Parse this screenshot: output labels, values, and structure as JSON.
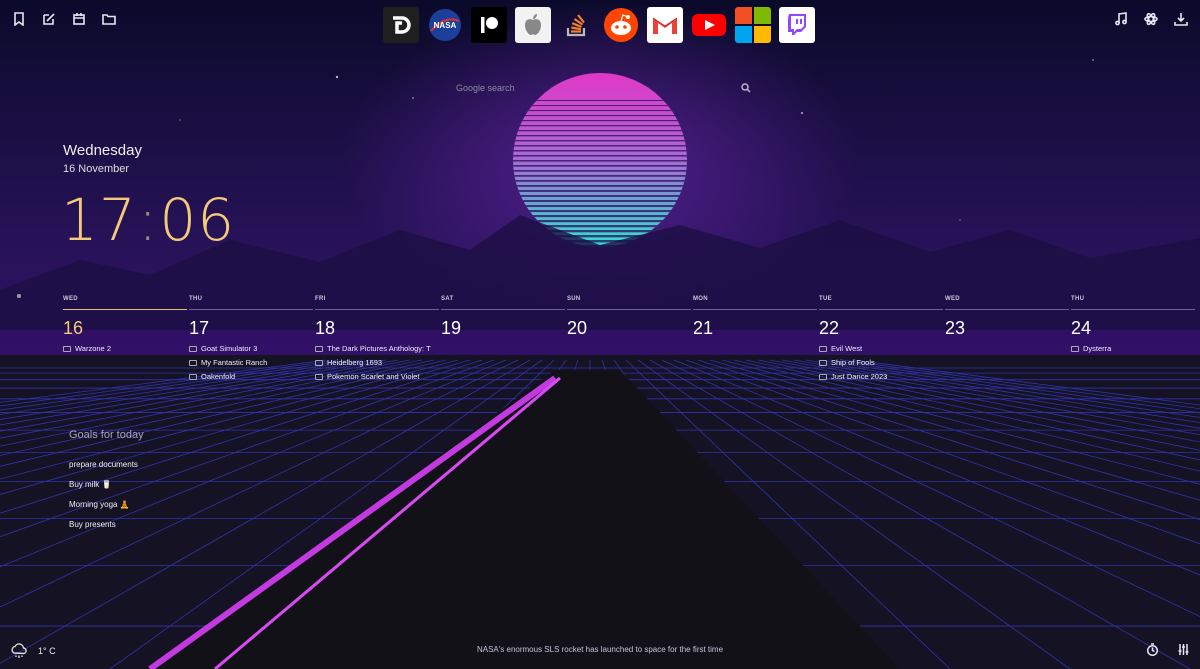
{
  "search": {
    "placeholder": "Google search"
  },
  "datetime": {
    "weekday": "Wednesday",
    "date": "16 November",
    "hours": "17",
    "minutes": "06"
  },
  "calendar": {
    "days": [
      {
        "wd": "WED",
        "num": "16",
        "events": [
          "Warzone 2"
        ]
      },
      {
        "wd": "THU",
        "num": "17",
        "events": [
          "Goat Simulator 3",
          "My Fantastic Ranch",
          "Oakenfold"
        ]
      },
      {
        "wd": "FRI",
        "num": "18",
        "events": [
          "The Dark Pictures Anthology: T",
          "Heidelberg 1693",
          "Pokemon Scarlet and Violet"
        ]
      },
      {
        "wd": "SAT",
        "num": "19",
        "events": []
      },
      {
        "wd": "SUN",
        "num": "20",
        "events": []
      },
      {
        "wd": "MON",
        "num": "21",
        "events": []
      },
      {
        "wd": "TUE",
        "num": "22",
        "events": [
          "Evil West",
          "Ship of Fools",
          "Just Dance 2023"
        ]
      },
      {
        "wd": "WED",
        "num": "23",
        "events": []
      },
      {
        "wd": "THU",
        "num": "24",
        "events": [
          "Dysterra"
        ]
      }
    ]
  },
  "goals": {
    "title": "Goals for today",
    "items": [
      "prepare documents",
      "Buy milk 🥛",
      "Morning yoga 🧘",
      "Buy presents"
    ]
  },
  "weather": {
    "temp": "1° C"
  },
  "news": {
    "headline": "NASA's enormous SLS rocket has launched to space for the first time"
  },
  "apps": [
    "dlsite",
    "nasa",
    "patreon",
    "apple",
    "stackoverflow",
    "reddit",
    "gmail",
    "youtube",
    "microsoft",
    "twitch"
  ],
  "apps_text": {
    "nasa": "NASA"
  },
  "colors": {
    "clock": "#f4c97a",
    "accent_sun_top": "#e040c8",
    "accent_sun_bottom": "#40e0d0",
    "grid": "#3f3fd8"
  }
}
